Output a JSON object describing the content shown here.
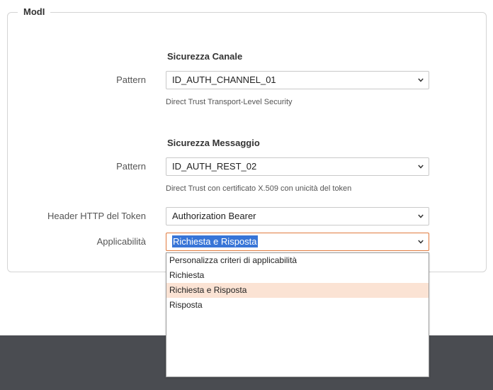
{
  "fieldset": {
    "legend": "ModI"
  },
  "sicurezza_canale": {
    "title": "Sicurezza Canale",
    "pattern_label": "Pattern",
    "pattern_value": "ID_AUTH_CHANNEL_01",
    "pattern_help": "Direct Trust Transport-Level Security"
  },
  "sicurezza_messaggio": {
    "title": "Sicurezza Messaggio",
    "pattern_label": "Pattern",
    "pattern_value": "ID_AUTH_REST_02",
    "pattern_help": "Direct Trust con certificato X.509 con unicità del token",
    "header_label": "Header HTTP del Token",
    "header_value": "Authorization Bearer",
    "applicabilita_label": "Applicabilità",
    "applicabilita_value": "Richiesta e Risposta"
  },
  "dropdown": {
    "options": [
      "Personalizza criteri di applicabilità",
      "Richiesta",
      "Richiesta e Risposta",
      "Risposta"
    ],
    "selected_index": 2
  },
  "colors": {
    "focus_border": "#e07b3f",
    "selected_option_bg": "#fbe3d4",
    "text_selection_bg": "#3875d7",
    "footer_bg": "#4a4c51"
  },
  "icons": {
    "select_arrow": "chevron-down-icon"
  }
}
